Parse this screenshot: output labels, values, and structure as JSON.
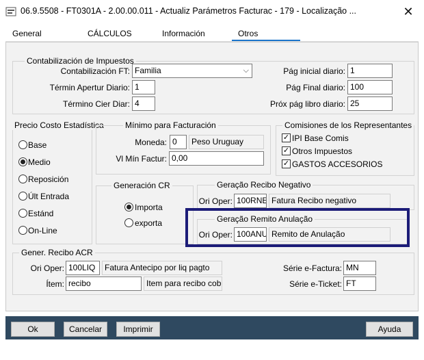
{
  "window": {
    "title": "06.9.5508 - FT0301A - 2.00.00.011 - Actualiz Parámetros Facturac - 179 - Localização ...",
    "close_glyph": "✕"
  },
  "tabs": [
    {
      "label": "General"
    },
    {
      "label": "CÁLCULOS"
    },
    {
      "label": "Información"
    },
    {
      "label": "Otros",
      "active": true
    }
  ],
  "contab": {
    "title": "Contabilización de Impuestos",
    "ft_label": "Contabilización FT:",
    "ft_value": "Familia",
    "apertur_label": "Términ Apertur Diario:",
    "apertur_value": "1",
    "cier_label": "Término Cier Diar:",
    "cier_value": "4",
    "pag_inicial_label": "Pág inicial diario:",
    "pag_inicial_value": "1",
    "pag_final_label": "Pág Final diario:",
    "pag_final_value": "100",
    "prox_label": "Próx pág libro diario:",
    "prox_value": "25"
  },
  "precio": {
    "title": "Precio Costo Estadística",
    "options": [
      {
        "label": "Base",
        "selected": false
      },
      {
        "label": "Medio",
        "selected": true
      },
      {
        "label": "Reposición",
        "selected": false
      },
      {
        "label": "Últ Entrada",
        "selected": false
      },
      {
        "label": "Estánd",
        "selected": false
      },
      {
        "label": "On-Line",
        "selected": false
      }
    ]
  },
  "minimo": {
    "title": "Mínimo para Facturación",
    "moneda_label": "Moneda:",
    "moneda_code": "0",
    "moneda_name": "Peso Uruguay",
    "vl_label": "Vl Mín Factur:",
    "vl_value": "0,00"
  },
  "comisiones": {
    "title": "Comisiones de los Representantes",
    "items": [
      {
        "label": "IPI Base Comis",
        "checked": true
      },
      {
        "label": "Otros Impuestos",
        "checked": true
      },
      {
        "label": "GASTOS ACCESORIOS",
        "checked": true
      }
    ]
  },
  "generacion_cr": {
    "title": "Generación CR",
    "options": [
      {
        "label": "Importa",
        "selected": true
      },
      {
        "label": "exporta",
        "selected": false
      }
    ]
  },
  "recibo_negativo": {
    "title": "Geração Recibo Negativo",
    "label": "Ori Oper:",
    "code": "100RNE",
    "desc": "Fatura Recibo negativo"
  },
  "remito_anulacao": {
    "title": "Geração Remito Anulação",
    "label": "Ori Oper:",
    "code": "100ANU",
    "desc": "Remito de Anulação"
  },
  "recibo_acr": {
    "title": "Gener. Recibo ACR",
    "ori_label": "Ori Oper:",
    "ori_code": "100LIQ",
    "ori_desc": "Fatura Antecipo por liq pagto",
    "item_label": "Ítem:",
    "item_code": "recibo",
    "item_desc": "Item para recibo cobranz",
    "serie_fact_label": "Série e-Factura:",
    "serie_fact_value": "MN",
    "serie_ticket_label": "Série e-Ticket:",
    "serie_ticket_value": "FT"
  },
  "buttons": {
    "ok": "Ok",
    "cancelar": "Cancelar",
    "imprimir": "Imprimir",
    "ayuda": "Ayuda"
  }
}
